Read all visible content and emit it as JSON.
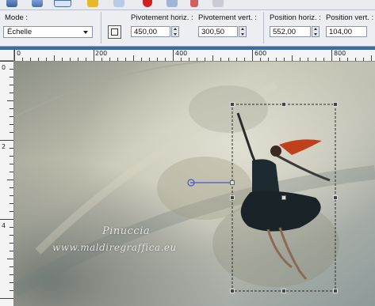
{
  "toolbar": {
    "icons": [
      "cube-icon",
      "grid-icon",
      "list-icon",
      "yellow-folder-icon",
      "blank-icon",
      "record-icon",
      "play-icon",
      "delete-icon",
      "save-icon"
    ]
  },
  "properties": {
    "mode_label": "Mode :",
    "mode_value": "Échelle",
    "pivot_x_label": "Pivotement horiz. :",
    "pivot_x_value": "450,00",
    "pivot_y_label": "Pivotement vert. :",
    "pivot_y_value": "300,50",
    "pos_x_label": "Position horiz. :",
    "pos_x_value": "552,00",
    "pos_y_label": "Position vert. :",
    "pos_y_value": "104,00"
  },
  "rulers": {
    "horizontal": [
      "0",
      "200",
      "400",
      "600",
      "800"
    ],
    "vertical": [
      "0",
      "2",
      "4"
    ]
  },
  "canvas": {
    "watermark_line1": "Pinuccia",
    "watermark_line2": "www.maldiregraffica.eu"
  }
}
